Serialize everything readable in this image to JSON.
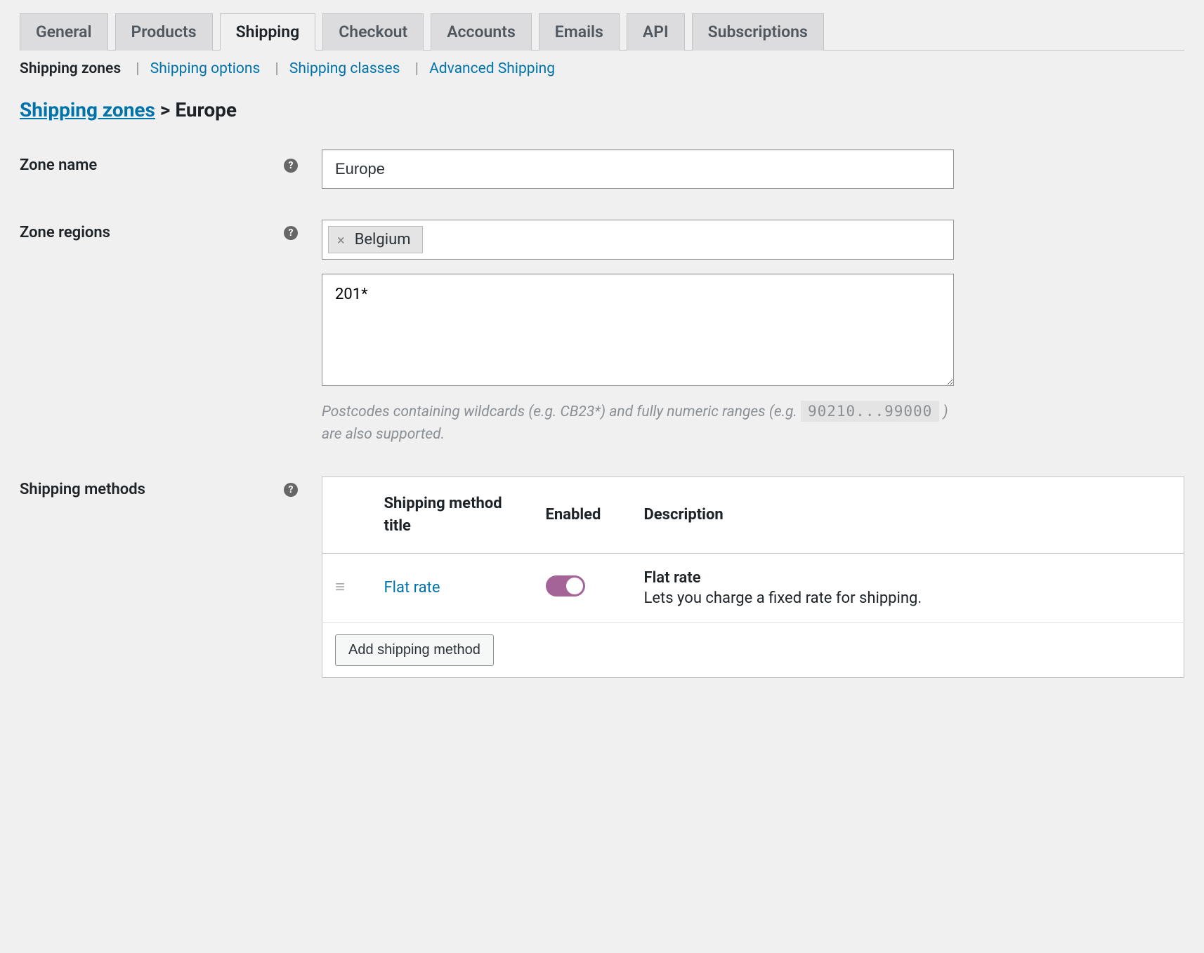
{
  "tabs": {
    "items": [
      {
        "label": "General",
        "active": false
      },
      {
        "label": "Products",
        "active": false
      },
      {
        "label": "Shipping",
        "active": true
      },
      {
        "label": "Checkout",
        "active": false
      },
      {
        "label": "Accounts",
        "active": false
      },
      {
        "label": "Emails",
        "active": false
      },
      {
        "label": "API",
        "active": false
      },
      {
        "label": "Subscriptions",
        "active": false
      }
    ]
  },
  "subtabs": {
    "items": [
      {
        "label": "Shipping zones",
        "active": true
      },
      {
        "label": "Shipping options",
        "active": false
      },
      {
        "label": "Shipping classes",
        "active": false
      },
      {
        "label": "Advanced Shipping",
        "active": false
      }
    ]
  },
  "breadcrumb": {
    "root": "Shipping zones",
    "separator": ">",
    "current": "Europe"
  },
  "form": {
    "zone_name": {
      "label": "Zone name",
      "value": "Europe"
    },
    "zone_regions": {
      "label": "Zone regions",
      "tags": [
        {
          "label": "Belgium"
        }
      ],
      "postcodes_value": "201*",
      "hint_prefix": "Postcodes containing wildcards (e.g. CB23*) and fully numeric ranges (e.g. ",
      "hint_code": "90210...99000",
      "hint_suffix": " ) are also supported."
    },
    "methods": {
      "label": "Shipping methods",
      "columns": {
        "title": "Shipping method title",
        "enabled": "Enabled",
        "description": "Description"
      },
      "rows": [
        {
          "title": "Flat rate",
          "enabled": true,
          "desc_title": "Flat rate",
          "desc_body": "Lets you charge a fixed rate for shipping."
        }
      ],
      "add_button": "Add shipping method"
    }
  }
}
